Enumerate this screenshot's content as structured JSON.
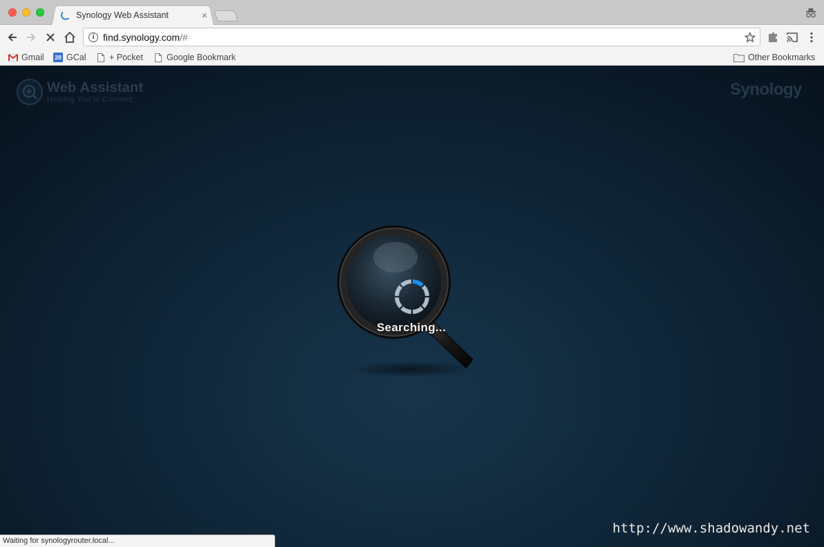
{
  "tab": {
    "title": "Synology Web Assistant",
    "close": "×"
  },
  "omnibox": {
    "host": "find.synology.com",
    "path": "/#"
  },
  "bookmarks": {
    "gmail": "Gmail",
    "gcal": "GCal",
    "gcal_badge": "28",
    "pocket": "+ Pocket",
    "google_bookmark": "Google Bookmark",
    "other": "Other Bookmarks"
  },
  "page": {
    "logo_title": "Web Assistant",
    "logo_subtitle": "Helping You to Connect",
    "brand": "Synology",
    "status": "Searching...",
    "watermark": "http://www.shadowandy.net"
  },
  "statusbar": {
    "text": "Waiting for synologyrouter.local..."
  },
  "colors": {
    "accent": "#3b87e2",
    "spinner_active": "#1d8ee8",
    "spinner_idle": "#aebdc8"
  }
}
